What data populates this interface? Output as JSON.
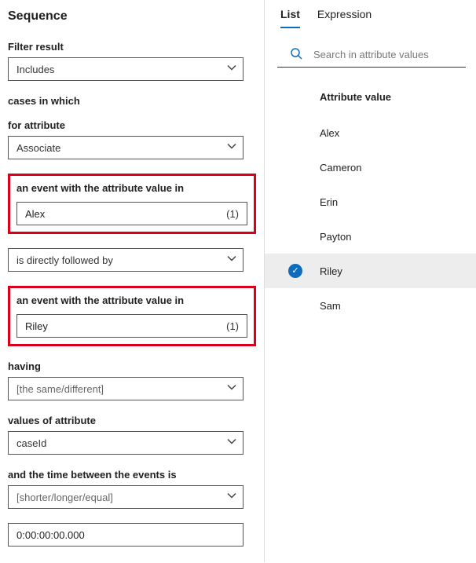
{
  "left": {
    "title": "Sequence",
    "filter_label": "Filter result",
    "filter_value": "Includes",
    "cases_text": "cases in which",
    "for_attr_label": "for attribute",
    "for_attr_value": "Associate",
    "event1_label": "an event with the attribute value in",
    "event1_value": "Alex",
    "event1_count": "(1)",
    "relation_value": "is directly followed by",
    "event2_label": "an event with the attribute value in",
    "event2_value": "Riley",
    "event2_count": "(1)",
    "having_label": "having",
    "having_value": "[the same/different]",
    "values_of_label": "values of attribute",
    "values_of_value": "caseId",
    "time_label": "and the time between the events is",
    "time_value": "[shorter/longer/equal]",
    "duration_value": "0:00:00:00.000"
  },
  "right": {
    "tabs": {
      "list": "List",
      "expression": "Expression"
    },
    "search_placeholder": "Search in attribute values",
    "header": "Attribute value",
    "items": [
      {
        "label": "Alex",
        "selected": false
      },
      {
        "label": "Cameron",
        "selected": false
      },
      {
        "label": "Erin",
        "selected": false
      },
      {
        "label": "Payton",
        "selected": false
      },
      {
        "label": "Riley",
        "selected": true
      },
      {
        "label": "Sam",
        "selected": false
      }
    ]
  }
}
